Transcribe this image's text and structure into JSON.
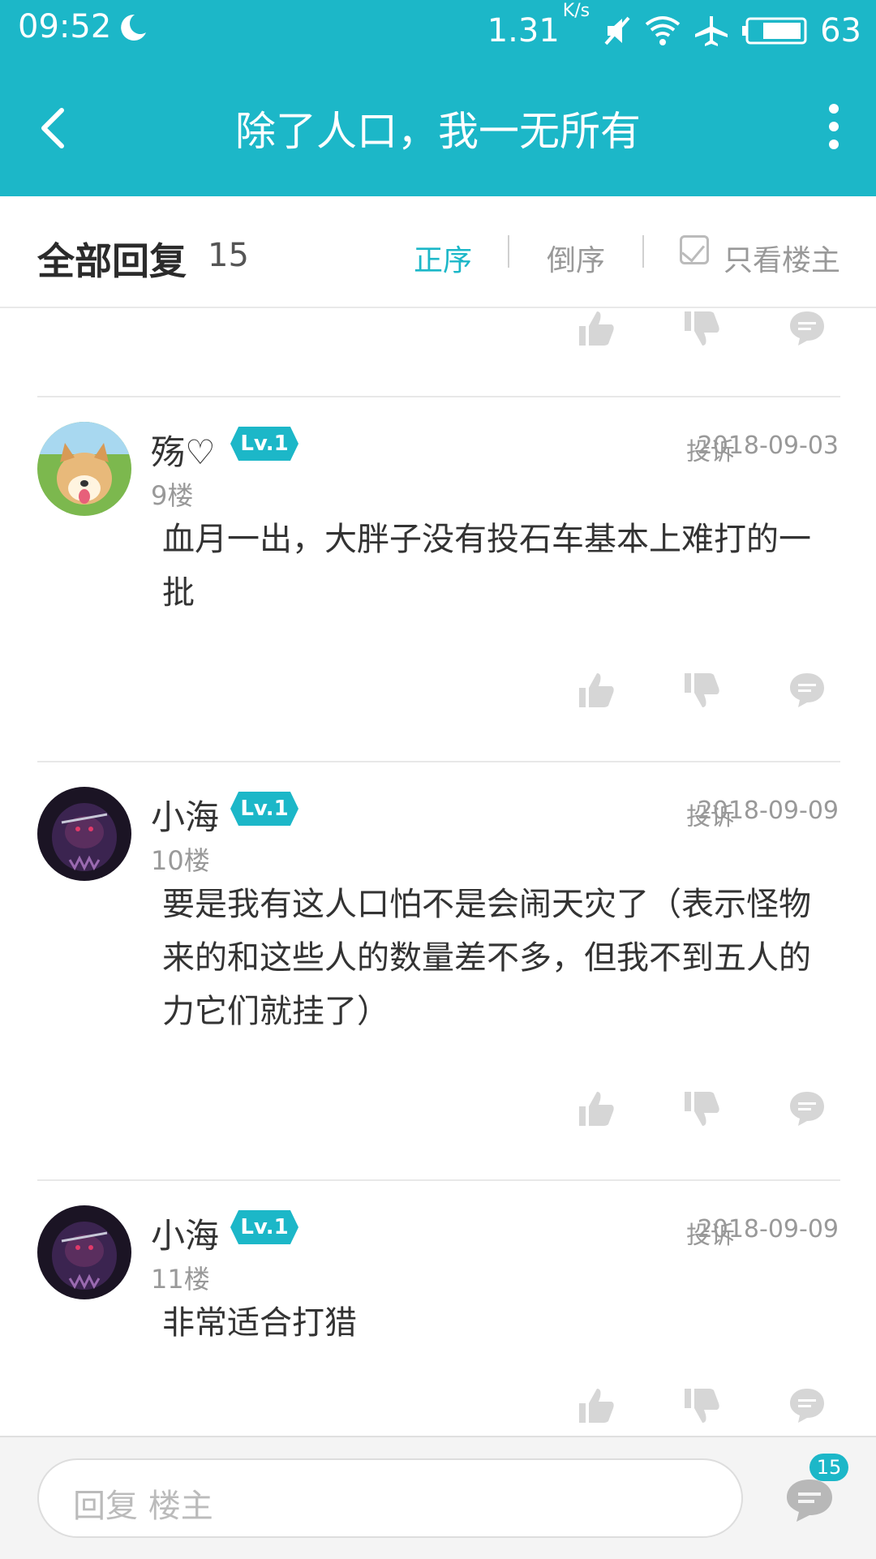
{
  "status": {
    "time": "09:52",
    "net_speed": "1.31",
    "net_speed_unit": "K/s",
    "battery": "63"
  },
  "nav": {
    "title": "除了人口，我一无所有"
  },
  "sortbar": {
    "all_replies": "全部回复",
    "count": "15",
    "asc": "正序",
    "desc": "倒序",
    "op_only": "只看楼主"
  },
  "posts": [
    {
      "username": "殇♡",
      "level": "Lv.1",
      "report": "投诉",
      "date": "2018-09-03",
      "floor": "9楼",
      "content": "血月一出，大胖子没有投石车基本上难打的一批"
    },
    {
      "username": "小海",
      "level": "Lv.1",
      "report": "投诉",
      "date": "2018-09-09",
      "floor": "10楼",
      "content": "要是我有这人口怕不是会闹天灾了（表示怪物来的和这些人的数量差不多，但我不到五人的力它们就挂了）"
    },
    {
      "username": "小海",
      "level": "Lv.1",
      "report": "投诉",
      "date": "2018-09-09",
      "floor": "11楼",
      "content": "非常适合打猎"
    }
  ],
  "bottom": {
    "reply_placeholder": "回复  楼主",
    "comment_count": "15"
  },
  "colors": {
    "accent": "#1cb7c8",
    "icon_gray": "#d6d6d6"
  }
}
